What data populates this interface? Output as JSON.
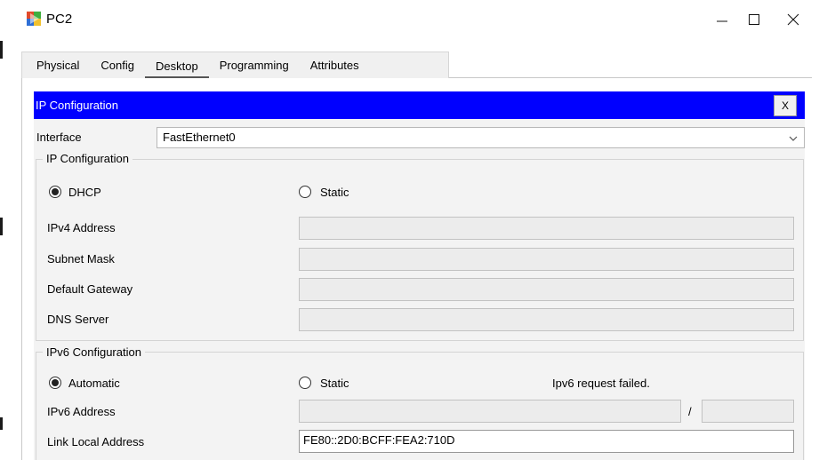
{
  "window": {
    "title": "PC2",
    "icon": "pc-icon",
    "controls": {
      "minimize": "—",
      "maximize": "☐",
      "close": "✕"
    }
  },
  "tabs": [
    {
      "label": "Physical",
      "active": false
    },
    {
      "label": "Config",
      "active": false
    },
    {
      "label": "Desktop",
      "active": true
    },
    {
      "label": "Programming",
      "active": false
    },
    {
      "label": "Attributes",
      "active": false
    }
  ],
  "ip_config": {
    "title": "IP Configuration",
    "close_label": "X",
    "header_color": "#0000ff",
    "interface_label": "Interface",
    "interface_value": "FastEthernet0",
    "ipv4": {
      "legend": "IP Configuration",
      "dhcp_label": "DHCP",
      "static_label": "Static",
      "mode": "DHCP",
      "ipv4_address_label": "IPv4 Address",
      "ipv4_address_value": "",
      "subnet_mask_label": "Subnet Mask",
      "subnet_mask_value": "",
      "default_gateway_label": "Default Gateway",
      "default_gateway_value": "",
      "dns_server_label": "DNS Server",
      "dns_server_value": ""
    },
    "ipv6": {
      "legend": "IPv6 Configuration",
      "automatic_label": "Automatic",
      "static_label": "Static",
      "mode": "Automatic",
      "status": "Ipv6 request failed.",
      "ipv6_address_label": "IPv6 Address",
      "ipv6_address_value": "",
      "prefix_separator": "/",
      "prefix_value": "",
      "link_local_label": "Link Local Address",
      "link_local_value": "FE80::2D0:BCFF:FEA2:710D"
    }
  }
}
